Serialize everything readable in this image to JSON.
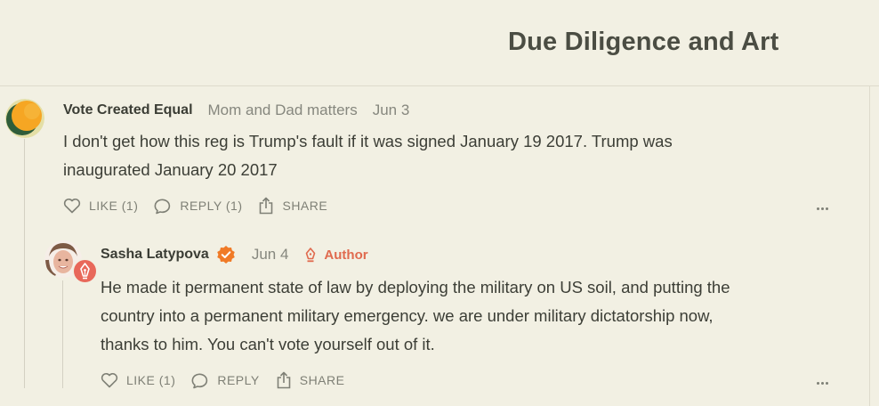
{
  "header": {
    "title": "Due Diligence and Art"
  },
  "comments": [
    {
      "author": "Vote Created Equal",
      "subtitle": "Mom and Dad matters",
      "date": "Jun 3",
      "body_line1": "I don't get how this reg is Trump's fault if it was signed January 19 2017. Trump was",
      "body_line2": "inaugurated January 20 2017",
      "like_label": "LIKE (1)",
      "reply_label": "REPLY (1)",
      "share_label": "SHARE",
      "avatar_icon": "abstract-orange-green-avatar"
    },
    {
      "author": "Sasha Latypova",
      "date": "Jun 4",
      "badge": "Author",
      "verified_icon": "verified-check-icon",
      "body_line1": "He made it permanent state of law by deploying the military on US soil, and putting the",
      "body_line2": "country into a permanent military emergency. we are under military dictatorship now,",
      "body_line3": "thanks to him. You can't vote yourself out of it.",
      "like_label": "LIKE (1)",
      "reply_label": "REPLY",
      "share_label": "SHARE",
      "avatar_icon": "person-photo-avatar"
    }
  ],
  "colors": {
    "background": "#f2f0e3",
    "accent": "#e06a4e",
    "verified": "#f07a26"
  }
}
